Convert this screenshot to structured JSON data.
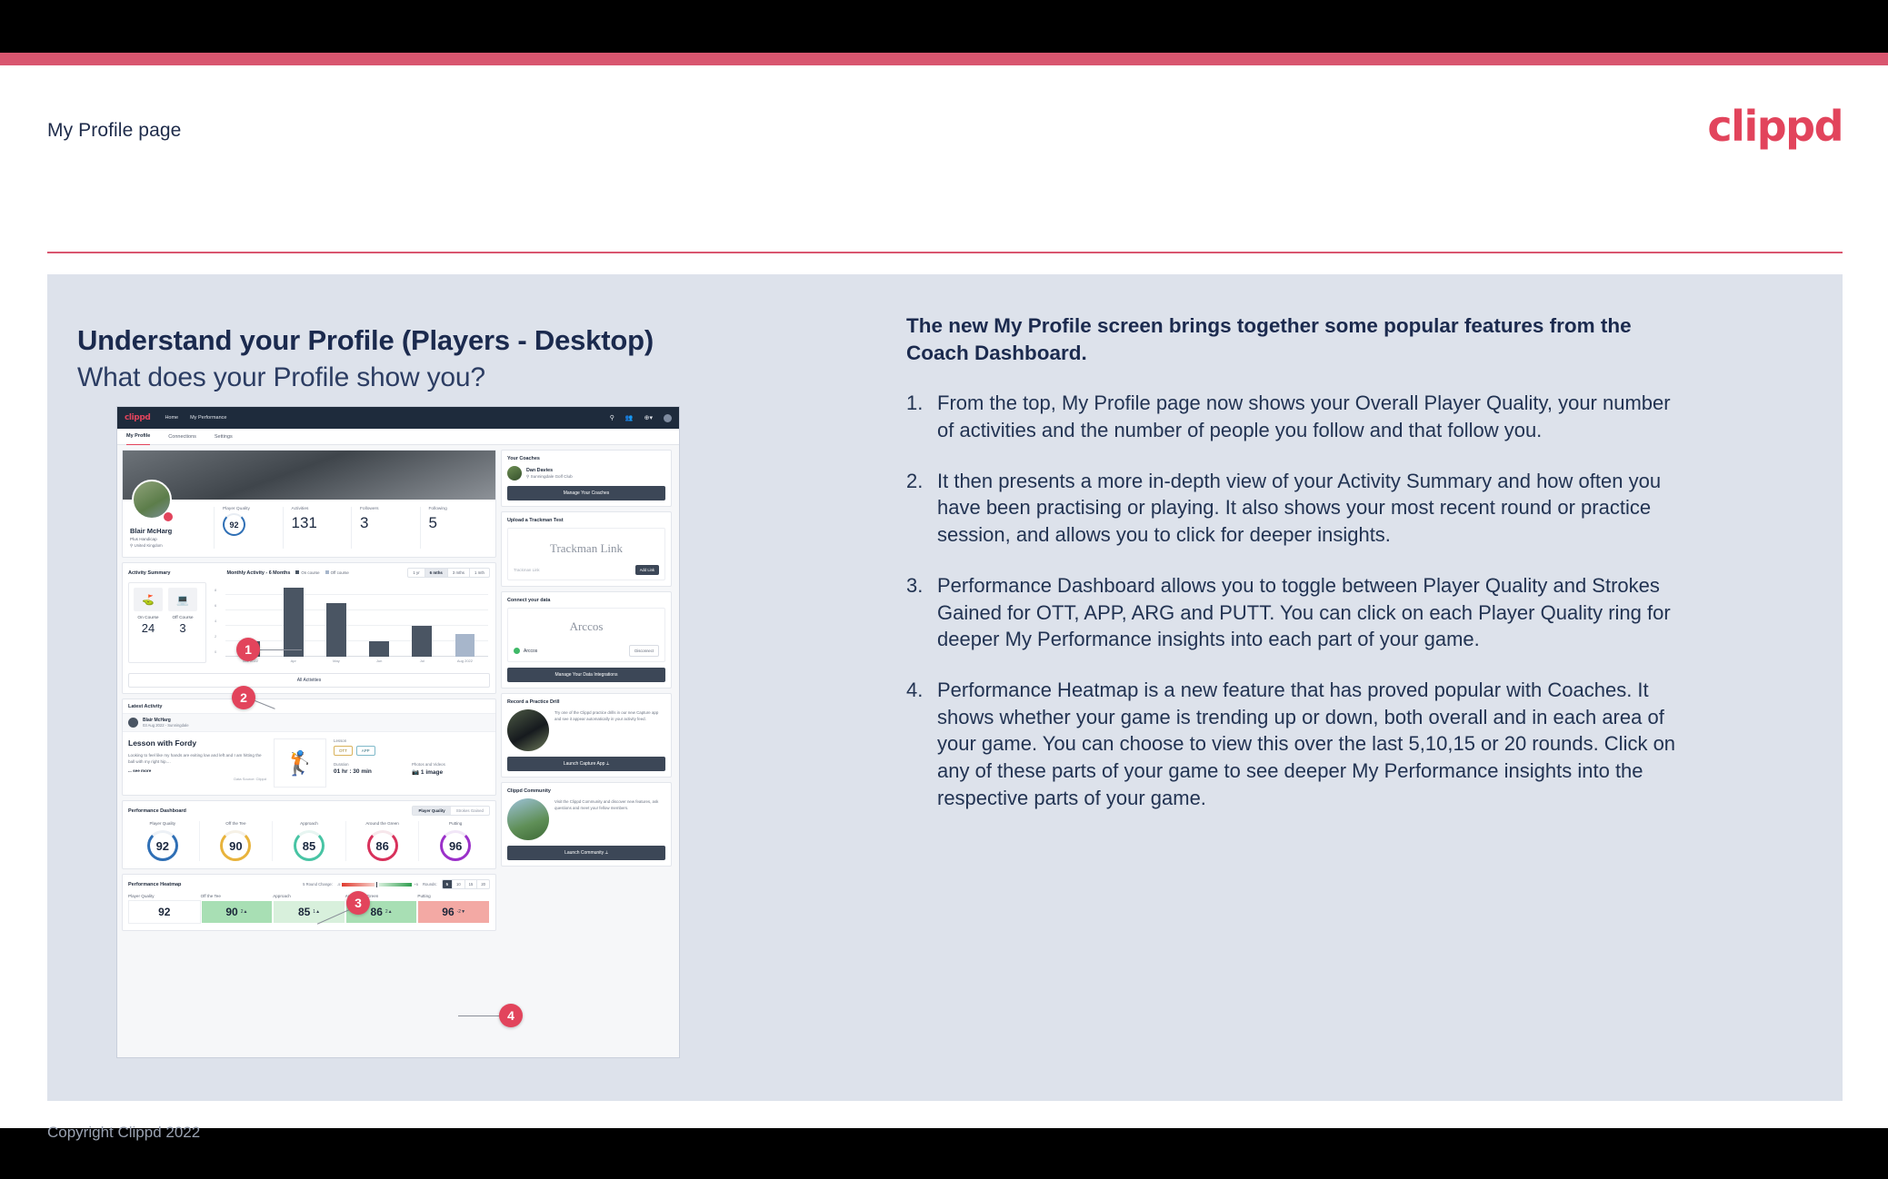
{
  "slide": {
    "header_title": "My Profile page",
    "logo": "clippd",
    "title": "Understand your Profile (Players - Desktop)",
    "subtitle": "What does your Profile show you?",
    "copyright": "Copyright Clippd 2022",
    "accent_color": "#d9566f",
    "panel_color": "#dde2eb"
  },
  "explainer": {
    "lead": "The new My Profile screen brings together some popular features from the Coach Dashboard.",
    "steps": [
      {
        "num": "1.",
        "text": "From the top, My Profile page now shows your Overall Player Quality, your number of activities and the number of people you follow and that follow you."
      },
      {
        "num": "2.",
        "text": "It then presents a more in-depth view of your Activity Summary and how often you have been practising or playing. It also shows your most recent round or practice session, and allows you to click for deeper insights."
      },
      {
        "num": "3.",
        "text": "Performance Dashboard allows you to toggle between Player Quality and Strokes Gained for OTT, APP, ARG and PUTT. You can click on each Player Quality ring for deeper My Performance insights into each part of your game."
      },
      {
        "num": "4.",
        "text": "Performance Heatmap is a new feature that has proved popular with Coaches. It shows whether your game is trending up or down, both overall and in each area of your game. You can choose to view this over the last 5,10,15 or 20 rounds. Click on any of these parts of your game to see deeper My Performance insights into the respective parts of your game."
      }
    ],
    "callouts": [
      "1",
      "2",
      "3",
      "4"
    ]
  },
  "app": {
    "nav": {
      "logo": "clippd",
      "links": [
        "Home",
        "My Performance"
      ],
      "icons": [
        "search-icon",
        "community-icon",
        "add-circle-icon",
        "avatar-icon"
      ]
    },
    "tabs": [
      {
        "label": "My Profile",
        "active": true
      },
      {
        "label": "Connections",
        "active": false
      },
      {
        "label": "Settings",
        "active": false
      }
    ],
    "profile": {
      "name": "Blair McHarg",
      "handicap": "Plus Handicap",
      "location": "United Kingdom",
      "player_quality_label": "Player Quality",
      "player_quality_value": "92",
      "stats": [
        {
          "label": "Activities",
          "value": "131"
        },
        {
          "label": "Followers",
          "value": "3"
        },
        {
          "label": "Following",
          "value": "5"
        }
      ]
    },
    "activity_summary": {
      "heading": "Activity Summary",
      "on_course_label": "On Course",
      "off_course_label": "Off Course",
      "on_course_value": "24",
      "off_course_value": "3",
      "all_activities": "All Activities",
      "chart_title": "Monthly Activity - 6 Months",
      "legend": [
        "On course",
        "Off course"
      ],
      "ranges": [
        {
          "label": "1 yr",
          "active": false
        },
        {
          "label": "6 mths",
          "active": true
        },
        {
          "label": "3 mths",
          "active": false
        },
        {
          "label": "1 mth",
          "active": false
        }
      ]
    },
    "latest_activity": {
      "heading": "Latest Activity",
      "user": "Blair McHarg",
      "date": "03 Aug 2022 - Sunningdale",
      "title": "Lesson with Fordy",
      "description": "Looking to feel like my hands are exiting low and left and I am hitting the ball with my right hip....",
      "see_more": "... see more",
      "source": "Data Source: Clippd",
      "lesson_label": "Lesson",
      "tags": [
        "OTT",
        "APP"
      ],
      "duration_label": "Duration",
      "duration_value": "01 hr : 30 min",
      "photos_label": "Photos and Videos",
      "photos_value": "1 image"
    },
    "performance_dashboard": {
      "heading": "Performance Dashboard",
      "toggle": [
        {
          "label": "Player Quality",
          "active": true
        },
        {
          "label": "Strokes Gained",
          "active": false
        }
      ]
    },
    "heatmap": {
      "heading": "Performance Heatmap",
      "change_label": "5 Round Change:",
      "scale_min": "-5",
      "scale_max": "+5",
      "rounds_label": "Rounds:",
      "rounds": [
        {
          "label": "5",
          "active": true
        },
        {
          "label": "10",
          "active": false
        },
        {
          "label": "15",
          "active": false
        },
        {
          "label": "20",
          "active": false
        }
      ]
    },
    "sidebar": {
      "coaches": {
        "heading": "Your Coaches",
        "coach_name": "Dan Davies",
        "coach_club": "Sunningdale Golf Club",
        "button": "Manage Your Coaches"
      },
      "trackman": {
        "heading": "Upload a Trackman Test",
        "brand": "Trackman Link",
        "placeholder": "Trackman Link",
        "button": "Add Link"
      },
      "connect": {
        "heading": "Connect your data",
        "brand": "Arccos",
        "provider": "Arccos",
        "disconnect": "Disconnect",
        "button": "Manage Your Data Integrations"
      },
      "practice": {
        "heading": "Record a Practice Drill",
        "text": "Try one of the Clippd practice drills in our new Capture app and see it appear automatically in your activity feed.",
        "button": "Launch Capture App"
      },
      "community": {
        "heading": "Clippd Community",
        "text": "Visit the Clippd Community and discover new features, ask questions and meet your fellow members.",
        "button": "Launch Community"
      }
    }
  },
  "chart_data": [
    {
      "type": "bar",
      "title": "Monthly Activity - 6 Months",
      "categories": [
        "Mar 2022",
        "Apr",
        "May",
        "Jun",
        "Jul",
        "Aug 2022"
      ],
      "series": [
        {
          "name": "On course",
          "values": [
            2,
            9,
            7,
            2,
            4,
            0
          ],
          "color": "#4a5563"
        },
        {
          "name": "Off course",
          "values": [
            0,
            0,
            0,
            0,
            0,
            3
          ],
          "color": "#a7b6cb"
        }
      ],
      "xlabel": "",
      "ylabel": "",
      "ylim": [
        0,
        9
      ],
      "yticks": [
        0,
        2,
        4,
        6,
        8
      ],
      "grid": true,
      "legend": "top-right"
    },
    {
      "type": "gauge",
      "title": "Performance Dashboard",
      "categories": [
        "Player Quality",
        "Off the Tee",
        "Approach",
        "Around the Green",
        "Putting"
      ],
      "values": [
        92,
        90,
        85,
        86,
        96
      ],
      "colors": [
        "#2f6fb5",
        "#e8b33c",
        "#48c4a4",
        "#d8315b",
        "#9b30c9"
      ],
      "ylim": [
        0,
        100
      ]
    },
    {
      "type": "heatmap",
      "title": "Performance Heatmap",
      "categories": [
        "Player Quality",
        "Off the Tee",
        "Approach",
        "Around the Green",
        "Putting"
      ],
      "values": [
        92,
        90,
        85,
        86,
        96
      ],
      "deltas": [
        "",
        "2",
        "1",
        "2",
        "-2"
      ],
      "delta_dirs": [
        "none",
        "up",
        "up",
        "up",
        "down"
      ],
      "cell_colors": [
        "#ffffff",
        "#a8dfb4",
        "#d8f0dc",
        "#a8dfb4",
        "#f3a9a4"
      ]
    }
  ]
}
